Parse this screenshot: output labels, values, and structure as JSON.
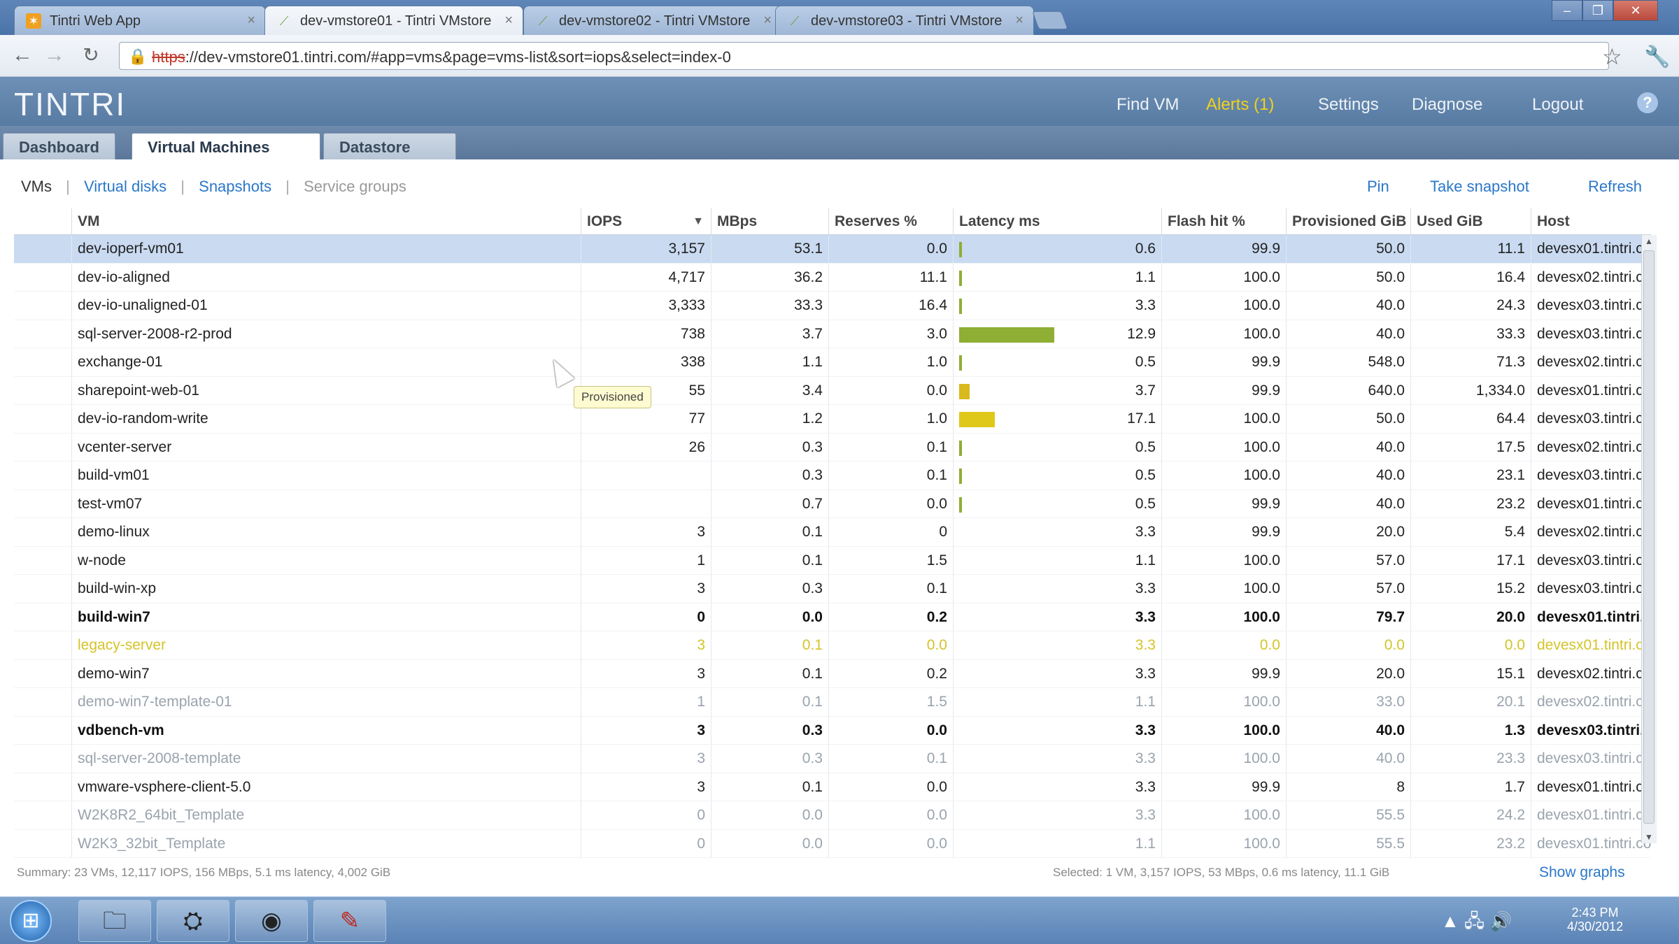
{
  "browser": {
    "tabs": [
      {
        "label": "Tintri Web App",
        "active": false
      },
      {
        "label": "dev-vmstore01 - Tintri VMstore",
        "active": true
      },
      {
        "label": "dev-vmstore02 - Tintri VMstore",
        "active": false
      },
      {
        "label": "dev-vmstore03 - Tintri VMstore",
        "active": false
      }
    ],
    "url_protocol": "https",
    "url_rest": "://dev-vmstore01.tintri.com/#app=vms&page=vms-list&sort=iops&select=index-0",
    "window_buttons": [
      "–",
      "❐",
      "✕"
    ]
  },
  "app": {
    "logo": "TINTRI",
    "header_links": [
      {
        "label": "Find VM"
      },
      {
        "label": "Alerts (1)",
        "alert": true
      },
      {
        "label": "Settings"
      },
      {
        "label": "Diagnose"
      },
      {
        "label": "Logout"
      }
    ],
    "help_label": "?",
    "tabs": [
      {
        "label": "Dashboard",
        "active": false
      },
      {
        "label": "Virtual Machines",
        "active": true
      },
      {
        "label": "Datastore",
        "active": false
      }
    ],
    "subnav": {
      "current": "VMs",
      "links": [
        "Virtual disks",
        "Snapshots"
      ],
      "muted": "Service groups"
    },
    "actions": [
      "Pin",
      "Take snapshot",
      "Refresh"
    ]
  },
  "table": {
    "columns": {
      "vm": "VM",
      "iops": "IOPS",
      "mbps": "MBps",
      "reserves": "Reserves %",
      "latency": "Latency ms",
      "flash": "Flash hit %",
      "provisioned": "Provisioned GiB",
      "used": "Used GiB",
      "host": "Host"
    },
    "sort_indicator": "▼",
    "rows": [
      {
        "vm": "dev-ioperf-vm01",
        "iops": "3,157",
        "mbps": "53.1",
        "reserves": "0.0",
        "latency": "0.6",
        "latency_bar": 0.02,
        "bar_color": "#8fae34",
        "flash": "99.9",
        "provisioned": "50.0",
        "used": "11.1",
        "host": "devesx01.tintri.com",
        "style": "sel"
      },
      {
        "vm": "dev-io-aligned",
        "iops": "4,717",
        "mbps": "36.2",
        "reserves": "11.1",
        "latency": "1.1",
        "latency_bar": 0.02,
        "bar_color": "#8fae34",
        "flash": "100.0",
        "provisioned": "50.0",
        "used": "16.4",
        "host": "devesx02.tintri.com",
        "style": ""
      },
      {
        "vm": "dev-io-unaligned-01",
        "iops": "3,333",
        "mbps": "33.3",
        "reserves": "16.4",
        "latency": "3.3",
        "latency_bar": 0.02,
        "bar_color": "#8fae34",
        "flash": "100.0",
        "provisioned": "40.0",
        "used": "24.3",
        "host": "devesx03.tintri.com",
        "style": ""
      },
      {
        "vm": "sql-server-2008-r2-prod",
        "iops": "738",
        "mbps": "3.7",
        "reserves": "3.0",
        "latency": "12.9",
        "latency_bar": 0.64,
        "bar_color": "#8fae34",
        "flash": "100.0",
        "provisioned": "40.0",
        "used": "33.3",
        "host": "devesx03.tintri.com",
        "style": ""
      },
      {
        "vm": "exchange-01",
        "iops": "338",
        "mbps": "1.1",
        "reserves": "1.0",
        "latency": "0.5",
        "latency_bar": 0.02,
        "bar_color": "#8fae34",
        "flash": "99.9",
        "provisioned": "548.0",
        "used": "71.3",
        "host": "devesx02.tintri.com",
        "style": ""
      },
      {
        "vm": "sharepoint-web-01",
        "iops": "55",
        "mbps": "3.4",
        "reserves": "0.0",
        "latency": "3.7",
        "latency_bar": 0.07,
        "bar_color": "#d9b91c",
        "flash": "99.9",
        "provisioned": "640.0",
        "used": "1,334.0",
        "host": "devesx01.tintri.com",
        "style": ""
      },
      {
        "vm": "dev-io-random-write",
        "iops": "77",
        "mbps": "1.2",
        "reserves": "1.0",
        "latency": "17.1",
        "latency_bar": 0.24,
        "bar_color": "#e0c81a",
        "flash": "100.0",
        "provisioned": "50.0",
        "used": "64.4",
        "host": "devesx03.tintri.com",
        "style": ""
      },
      {
        "vm": "vcenter-server",
        "iops": "26",
        "mbps": "0.3",
        "reserves": "0.1",
        "latency": "0.5",
        "latency_bar": 0.02,
        "bar_color": "#8fae34",
        "flash": "100.0",
        "provisioned": "40.0",
        "used": "17.5",
        "host": "devesx02.tintri.com",
        "style": ""
      },
      {
        "vm": "build-vm01",
        "iops": "",
        "mbps": "0.3",
        "reserves": "0.1",
        "latency": "0.5",
        "latency_bar": 0.02,
        "bar_color": "#8fae34",
        "flash": "100.0",
        "provisioned": "40.0",
        "used": "23.1",
        "host": "devesx03.tintri.com",
        "style": ""
      },
      {
        "vm": "test-vm07",
        "iops": "",
        "mbps": "0.7",
        "reserves": "0.0",
        "latency": "0.5",
        "latency_bar": 0.02,
        "bar_color": "#8fae34",
        "flash": "99.9",
        "provisioned": "40.0",
        "used": "23.2",
        "host": "devesx01.tintri.com",
        "style": ""
      },
      {
        "vm": "demo-linux",
        "iops": "3",
        "mbps": "0.1",
        "reserves": "0",
        "latency": "3.3",
        "latency_bar": 0,
        "bar_color": "#8fae34",
        "flash": "99.9",
        "provisioned": "20.0",
        "used": "5.4",
        "host": "devesx02.tintri.com",
        "style": ""
      },
      {
        "vm": "w-node",
        "iops": "1",
        "mbps": "0.1",
        "reserves": "1.5",
        "latency": "1.1",
        "latency_bar": 0,
        "bar_color": "#8fae34",
        "flash": "100.0",
        "provisioned": "57.0",
        "used": "17.1",
        "host": "devesx03.tintri.com",
        "style": ""
      },
      {
        "vm": "build-win-xp",
        "iops": "3",
        "mbps": "0.3",
        "reserves": "0.1",
        "latency": "3.3",
        "latency_bar": 0,
        "bar_color": "#8fae34",
        "flash": "100.0",
        "provisioned": "57.0",
        "used": "15.2",
        "host": "devesx03.tintri.com",
        "style": ""
      },
      {
        "vm": "build-win7",
        "iops": "0",
        "mbps": "0.0",
        "reserves": "0.2",
        "latency": "3.3",
        "latency_bar": 0,
        "bar_color": "#8fae34",
        "flash": "100.0",
        "provisioned": "79.7",
        "used": "20.0",
        "host": "devesx01.tintri.com",
        "style": "bold"
      },
      {
        "vm": "legacy-server",
        "iops": "3",
        "mbps": "0.1",
        "reserves": "0.0",
        "latency": "3.3",
        "latency_bar": 0,
        "bar_color": "#8fae34",
        "flash": "0.0",
        "provisioned": "0.0",
        "used": "0.0",
        "host": "devesx01.tintri.com",
        "style": "warn"
      },
      {
        "vm": "demo-win7",
        "iops": "3",
        "mbps": "0.1",
        "reserves": "0.2",
        "latency": "3.3",
        "latency_bar": 0,
        "bar_color": "#8fae34",
        "flash": "99.9",
        "provisioned": "20.0",
        "used": "15.1",
        "host": "devesx02.tintri.com",
        "style": ""
      },
      {
        "vm": "demo-win7-template-01",
        "iops": "1",
        "mbps": "0.1",
        "reserves": "1.5",
        "latency": "1.1",
        "latency_bar": 0,
        "bar_color": "#8fae34",
        "flash": "100.0",
        "provisioned": "33.0",
        "used": "20.1",
        "host": "devesx02.tintri.com",
        "style": "dim"
      },
      {
        "vm": "vdbench-vm",
        "iops": "3",
        "mbps": "0.3",
        "reserves": "0.0",
        "latency": "3.3",
        "latency_bar": 0,
        "bar_color": "#8fae34",
        "flash": "100.0",
        "provisioned": "40.0",
        "used": "1.3",
        "host": "devesx03.tintri.com",
        "style": "bold"
      },
      {
        "vm": "sql-server-2008-template",
        "iops": "3",
        "mbps": "0.3",
        "reserves": "0.1",
        "latency": "3.3",
        "latency_bar": 0,
        "bar_color": "#8fae34",
        "flash": "100.0",
        "provisioned": "40.0",
        "used": "23.3",
        "host": "devesx03.tintri.com",
        "style": "dim"
      },
      {
        "vm": "vmware-vsphere-client-5.0",
        "iops": "3",
        "mbps": "0.1",
        "reserves": "0.0",
        "latency": "3.3",
        "latency_bar": 0,
        "bar_color": "#8fae34",
        "flash": "99.9",
        "provisioned": "8",
        "used": "1.7",
        "host": "devesx01.tintri.com",
        "style": ""
      },
      {
        "vm": "W2K8R2_64bit_Template",
        "iops": "0",
        "mbps": "0.0",
        "reserves": "0.0",
        "latency": "3.3",
        "latency_bar": 0,
        "bar_color": "#8fae34",
        "flash": "100.0",
        "provisioned": "55.5",
        "used": "24.2",
        "host": "devesx01.tintri.com",
        "style": "dim"
      },
      {
        "vm": "W2K3_32bit_Template",
        "iops": "0",
        "mbps": "0.0",
        "reserves": "0.0",
        "latency": "1.1",
        "latency_bar": 0,
        "bar_color": "#8fae34",
        "flash": "100.0",
        "provisioned": "55.5",
        "used": "23.2",
        "host": "devesx01.tintri.com",
        "style": "dim"
      }
    ],
    "footer_left": "Summary: 23 VMs, 12,117 IOPS, 156 MBps, 5.1 ms latency, 4,002 GiB",
    "footer_right": "Selected: 1 VM, 3,157 IOPS, 53 MBps, 0.6 ms latency, 11.1 GiB",
    "show_graphs": "Show graphs"
  },
  "tooltip": "Provisioned",
  "taskbar": {
    "start_icon": "⊞",
    "items": [
      {
        "icon": "folder-icon",
        "glyph": "🗀"
      },
      {
        "icon": "vsphere-client-icon",
        "glyph": "⛭"
      },
      {
        "icon": "chrome-icon",
        "glyph": "◉"
      },
      {
        "icon": "acrobat-icon",
        "glyph": "✎"
      }
    ],
    "tray": "▲  🖧  🔊",
    "time": "2:43 PM",
    "date": "4/30/2012"
  }
}
